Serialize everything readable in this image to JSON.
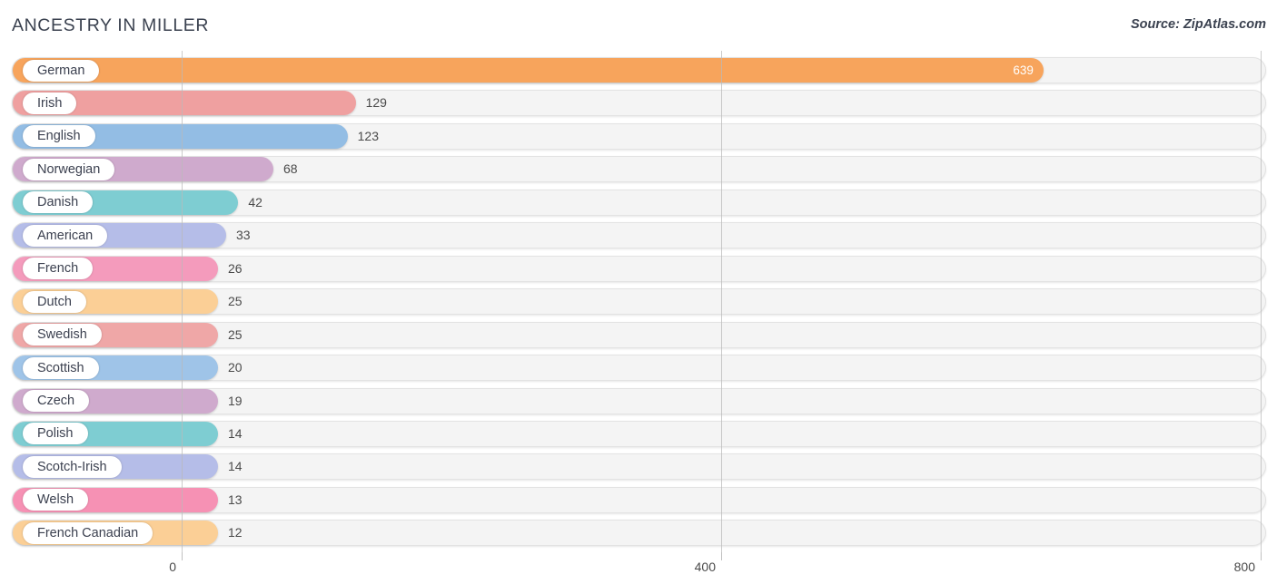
{
  "header": {
    "title": "ANCESTRY IN MILLER",
    "source": "Source: ZipAtlas.com"
  },
  "chart_data": {
    "type": "bar",
    "orientation": "horizontal",
    "title": "ANCESTRY IN MILLER",
    "subtitle": "",
    "xlabel": "",
    "ylabel": "",
    "xlim": [
      0,
      800
    ],
    "xticks": [
      0,
      400,
      800
    ],
    "xtick_labels": [
      "0",
      "400",
      "800"
    ],
    "grid": true,
    "legend": false,
    "categories": [
      "German",
      "Irish",
      "English",
      "Norwegian",
      "Danish",
      "American",
      "French",
      "Dutch",
      "Swedish",
      "Scottish",
      "Czech",
      "Polish",
      "Scotch-Irish",
      "Welsh",
      "French Canadian"
    ],
    "values": [
      639,
      129,
      123,
      68,
      42,
      33,
      26,
      25,
      25,
      20,
      19,
      14,
      14,
      13,
      12
    ],
    "value_labels": [
      "639",
      "129",
      "123",
      "68",
      "42",
      "33",
      "26",
      "25",
      "25",
      "20",
      "19",
      "14",
      "14",
      "13",
      "12"
    ],
    "colors": [
      "#f7a45c",
      "#efa0a0",
      "#93bde4",
      "#cfaacd",
      "#7ecdd2",
      "#b5bde8",
      "#f49bbc",
      "#fbcf96",
      "#efa7a7",
      "#9fc4e8",
      "#cfaacd",
      "#7ecdd2",
      "#b5bde8",
      "#f691b4",
      "#fbcf96"
    ],
    "bars": [
      {
        "label": "German",
        "value": 639,
        "value_label": "639",
        "color": "#f7a45c",
        "label_inside": true
      },
      {
        "label": "Irish",
        "value": 129,
        "value_label": "129",
        "color": "#efa0a0",
        "label_inside": false
      },
      {
        "label": "English",
        "value": 123,
        "value_label": "123",
        "color": "#93bde4",
        "label_inside": false
      },
      {
        "label": "Norwegian",
        "value": 68,
        "value_label": "68",
        "color": "#cfaacd",
        "label_inside": false
      },
      {
        "label": "Danish",
        "value": 42,
        "value_label": "42",
        "color": "#7ecdd2",
        "label_inside": false
      },
      {
        "label": "American",
        "value": 33,
        "value_label": "33",
        "color": "#b5bde8",
        "label_inside": false
      },
      {
        "label": "French",
        "value": 26,
        "value_label": "26",
        "color": "#f49bbc",
        "label_inside": false
      },
      {
        "label": "Dutch",
        "value": 25,
        "value_label": "25",
        "color": "#fbcf96",
        "label_inside": false
      },
      {
        "label": "Swedish",
        "value": 25,
        "value_label": "25",
        "color": "#efa7a7",
        "label_inside": false
      },
      {
        "label": "Scottish",
        "value": 20,
        "value_label": "20",
        "color": "#9fc4e8",
        "label_inside": false
      },
      {
        "label": "Czech",
        "value": 19,
        "value_label": "19",
        "color": "#cfaacd",
        "label_inside": false
      },
      {
        "label": "Polish",
        "value": 14,
        "value_label": "14",
        "color": "#7ecdd2",
        "label_inside": false
      },
      {
        "label": "Scotch-Irish",
        "value": 14,
        "value_label": "14",
        "color": "#b5bde8",
        "label_inside": false
      },
      {
        "label": "Welsh",
        "value": 13,
        "value_label": "13",
        "color": "#f691b4",
        "label_inside": false
      },
      {
        "label": "French Canadian",
        "value": 12,
        "value_label": "12",
        "color": "#fbcf96",
        "label_inside": false
      }
    ]
  }
}
